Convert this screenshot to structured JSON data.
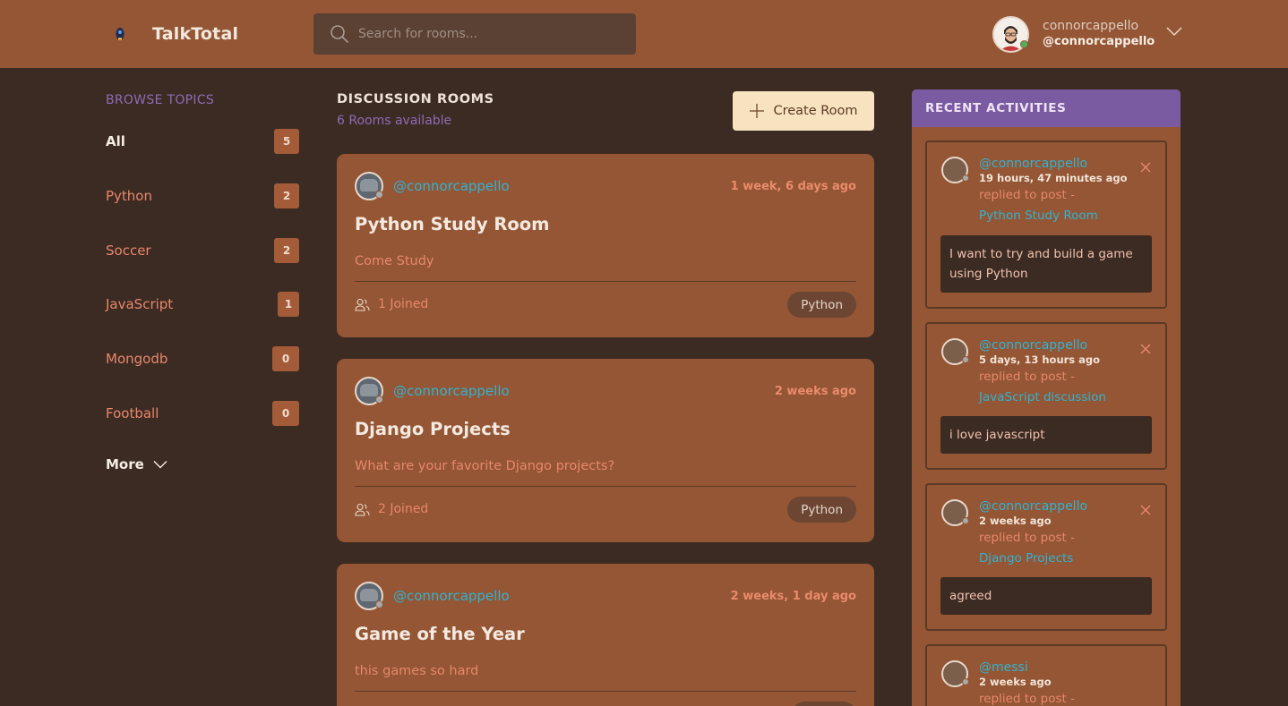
{
  "brand": {
    "name": "TalkTotal"
  },
  "search": {
    "placeholder": "Search for rooms..."
  },
  "user": {
    "name": "connorcappello",
    "handle": "@connorcappello"
  },
  "topics": {
    "title": "BROWSE TOPICS",
    "items": [
      {
        "label": "All",
        "count": "5"
      },
      {
        "label": "Python",
        "count": "2"
      },
      {
        "label": "Soccer",
        "count": "2"
      },
      {
        "label": "JavaScript",
        "count": "1"
      },
      {
        "label": "Mongodb",
        "count": "0"
      },
      {
        "label": "Football",
        "count": "0"
      }
    ],
    "more_label": "More"
  },
  "rooms": {
    "title": "DISCUSSION ROOMS",
    "subtitle": "6 Rooms available",
    "create_label": "Create Room",
    "items": [
      {
        "host": "@connorcappello",
        "time": "1 week, 6 days ago",
        "title": "Python Study Room",
        "description": "Come Study",
        "joined": "1 Joined",
        "topic": "Python"
      },
      {
        "host": "@connorcappello",
        "time": "2 weeks ago",
        "title": "Django Projects",
        "description": "What are your favorite Django projects?",
        "joined": "2 Joined",
        "topic": "Python"
      },
      {
        "host": "@connorcappello",
        "time": "2 weeks, 1 day ago",
        "title": "Game of the Year",
        "description": "this games so hard",
        "joined": "",
        "topic": ""
      }
    ]
  },
  "activities": {
    "title": "RECENT ACTIVITIES",
    "items": [
      {
        "user": "@connorcappello",
        "time": "19 hours, 47 minutes ago",
        "action": "replied to post -",
        "room": "Python Study Room",
        "message": "I want to try and build a game using Python"
      },
      {
        "user": "@connorcappello",
        "time": "5 days, 13 hours ago",
        "action": "replied to post -",
        "room": "JavaScript discussion",
        "message": "i love javascript"
      },
      {
        "user": "@connorcappello",
        "time": "2 weeks ago",
        "action": "replied to post -",
        "room": "Django Projects",
        "message": "agreed"
      },
      {
        "user": "@messi",
        "time": "2 weeks ago",
        "action": "replied to post -",
        "room": "",
        "message": ""
      }
    ]
  },
  "colors": {
    "header": "#945634",
    "background": "#3c2b23",
    "card": "#945634",
    "accent_purple": "#7a5aa1",
    "link_cyan": "#30b3d3",
    "muted_orange": "#e8876c",
    "create_button": "#f7e3bf"
  }
}
